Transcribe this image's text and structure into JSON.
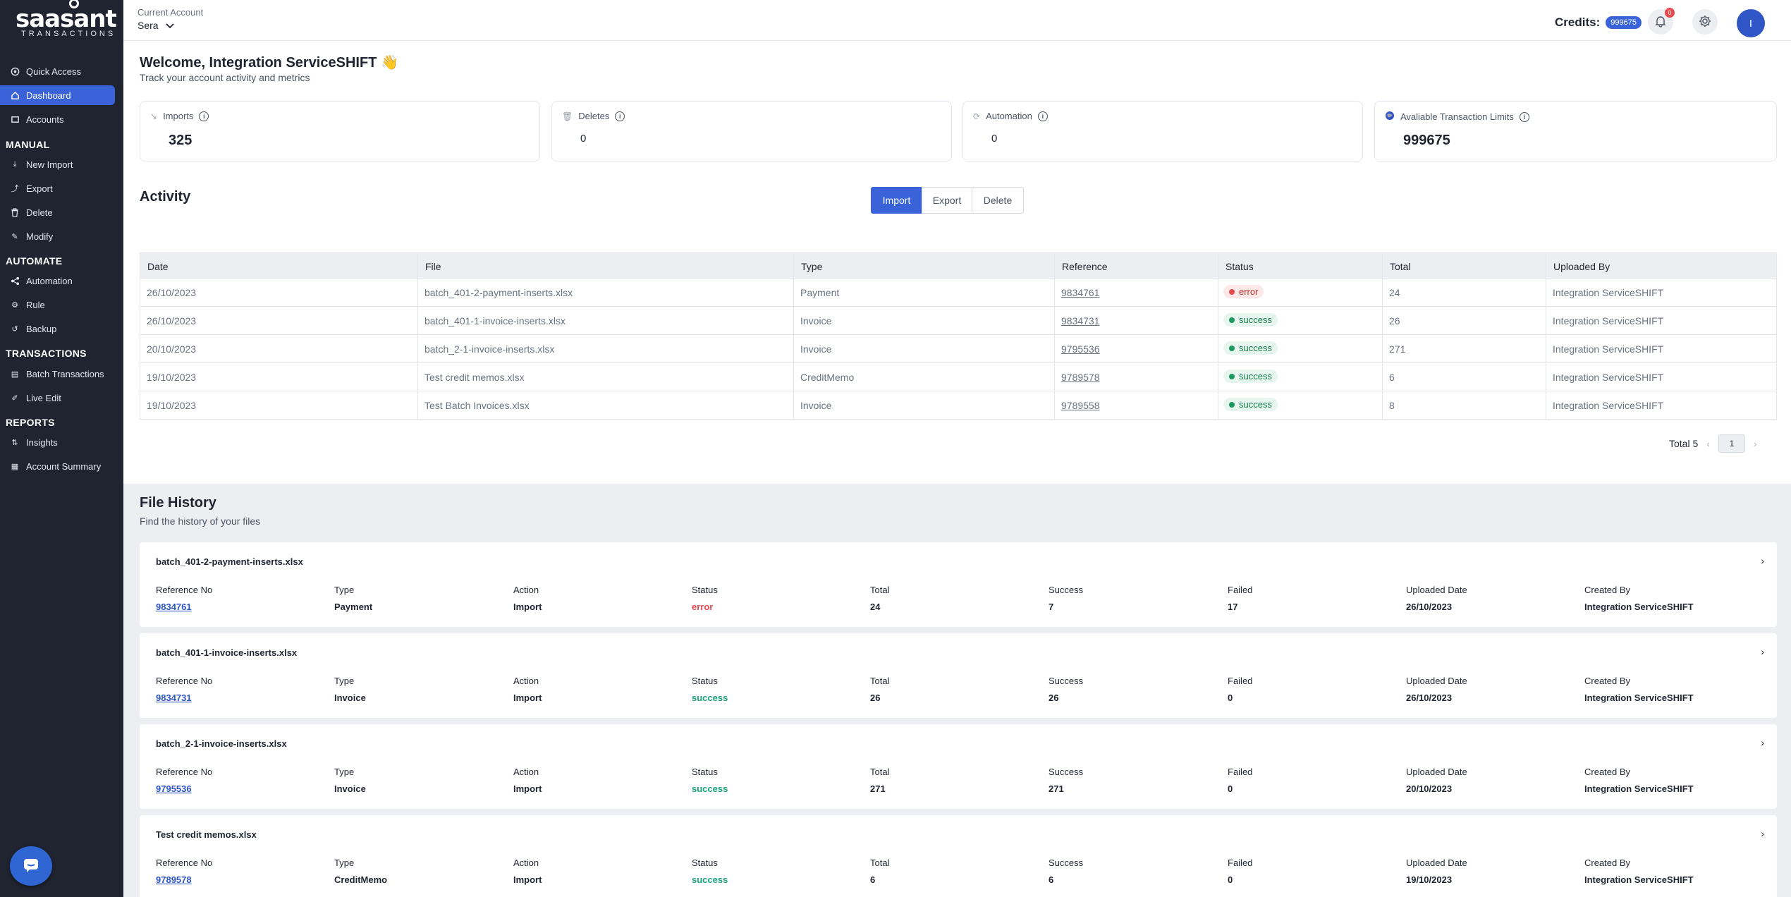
{
  "brand": {
    "logo_text": "saasant",
    "logo_sub": "TRANSACTIONS"
  },
  "sidebar": {
    "items_top": [
      {
        "label": "Quick Access",
        "icon": "quick-access-icon"
      },
      {
        "label": "Dashboard",
        "icon": "home-icon",
        "active": true
      },
      {
        "label": "Accounts",
        "icon": "accounts-icon"
      }
    ],
    "sections": [
      {
        "title": "MANUAL",
        "items": [
          {
            "label": "New Import",
            "icon": "import-icon"
          },
          {
            "label": "Export",
            "icon": "export-icon"
          },
          {
            "label": "Delete",
            "icon": "trash-icon"
          },
          {
            "label": "Modify",
            "icon": "edit-icon"
          }
        ]
      },
      {
        "title": "AUTOMATE",
        "items": [
          {
            "label": "Automation",
            "icon": "share-icon"
          },
          {
            "label": "Rule",
            "icon": "rule-icon"
          },
          {
            "label": "Backup",
            "icon": "backup-icon"
          }
        ]
      },
      {
        "title": "TRANSACTIONS",
        "items": [
          {
            "label": "Batch Transactions",
            "icon": "batch-icon"
          },
          {
            "label": "Live Edit",
            "icon": "live-edit-icon"
          }
        ]
      },
      {
        "title": "REPORTS",
        "items": [
          {
            "label": "Insights",
            "icon": "insights-icon"
          },
          {
            "label": "Account Summary",
            "icon": "summary-icon"
          }
        ]
      }
    ]
  },
  "topbar": {
    "account_label": "Current Account",
    "account_value": "Sera",
    "credits_label": "Credits:",
    "credits_value": "999675",
    "notif_count": "0",
    "avatar_initial": "I"
  },
  "welcome": {
    "title": "Welcome, Integration ServiceSHIFT 👋",
    "subtitle": "Track your account activity and metrics"
  },
  "stats": [
    {
      "label": "Imports",
      "value": "325",
      "icon": "imports-icon"
    },
    {
      "label": "Deletes",
      "value": "0",
      "icon": "trash-icon"
    },
    {
      "label": "Automation",
      "value": "0",
      "icon": "sync-icon"
    },
    {
      "label": "Avaliable Transaction Limits",
      "value": "999675",
      "icon": "globe-icon"
    }
  ],
  "activity": {
    "title": "Activity",
    "tabs": [
      "Import",
      "Export",
      "Delete"
    ],
    "columns": [
      "Date",
      "File",
      "Type",
      "Reference",
      "Status",
      "Total",
      "Uploaded By"
    ],
    "rows": [
      {
        "date": "26/10/2023",
        "file": "batch_401-2-payment-inserts.xlsx",
        "type": "Payment",
        "reference": "9834761",
        "status": "error",
        "total": "24",
        "uploaded_by": "Integration ServiceSHIFT"
      },
      {
        "date": "26/10/2023",
        "file": "batch_401-1-invoice-inserts.xlsx",
        "type": "Invoice",
        "reference": "9834731",
        "status": "success",
        "total": "26",
        "uploaded_by": "Integration ServiceSHIFT"
      },
      {
        "date": "20/10/2023",
        "file": "batch_2-1-invoice-inserts.xlsx",
        "type": "Invoice",
        "reference": "9795536",
        "status": "success",
        "total": "271",
        "uploaded_by": "Integration ServiceSHIFT"
      },
      {
        "date": "19/10/2023",
        "file": "Test credit memos.xlsx",
        "type": "CreditMemo",
        "reference": "9789578",
        "status": "success",
        "total": "6",
        "uploaded_by": "Integration ServiceSHIFT"
      },
      {
        "date": "19/10/2023",
        "file": "Test Batch Invoices.xlsx",
        "type": "Invoice",
        "reference": "9789558",
        "status": "success",
        "total": "8",
        "uploaded_by": "Integration ServiceSHIFT"
      }
    ],
    "total_label": "Total 5",
    "page": "1"
  },
  "file_history": {
    "title": "File History",
    "subtitle": "Find the history of your files",
    "field_labels": [
      "Reference No",
      "Type",
      "Action",
      "Status",
      "Total",
      "Success",
      "Failed",
      "Uploaded Date",
      "Created By"
    ],
    "cards": [
      {
        "name": "batch_401-2-payment-inserts.xlsx",
        "reference": "9834761",
        "type": "Payment",
        "action": "Import",
        "status": "error",
        "total": "24",
        "success": "7",
        "failed": "17",
        "uploaded": "26/10/2023",
        "created_by": "Integration ServiceSHIFT"
      },
      {
        "name": "batch_401-1-invoice-inserts.xlsx",
        "reference": "9834731",
        "type": "Invoice",
        "action": "Import",
        "status": "success",
        "total": "26",
        "success": "26",
        "failed": "0",
        "uploaded": "26/10/2023",
        "created_by": "Integration ServiceSHIFT"
      },
      {
        "name": "batch_2-1-invoice-inserts.xlsx",
        "reference": "9795536",
        "type": "Invoice",
        "action": "Import",
        "status": "success",
        "total": "271",
        "success": "271",
        "failed": "0",
        "uploaded": "20/10/2023",
        "created_by": "Integration ServiceSHIFT"
      },
      {
        "name": "Test credit memos.xlsx",
        "reference": "9789578",
        "type": "CreditMemo",
        "action": "Import",
        "status": "success",
        "total": "6",
        "success": "6",
        "failed": "0",
        "uploaded": "19/10/2023",
        "created_by": "Integration ServiceSHIFT"
      }
    ]
  },
  "colors": {
    "sidebar_bg": "#1f2430",
    "accent": "#3b63d9",
    "success": "#1a9a5f",
    "error": "#e5484d"
  }
}
